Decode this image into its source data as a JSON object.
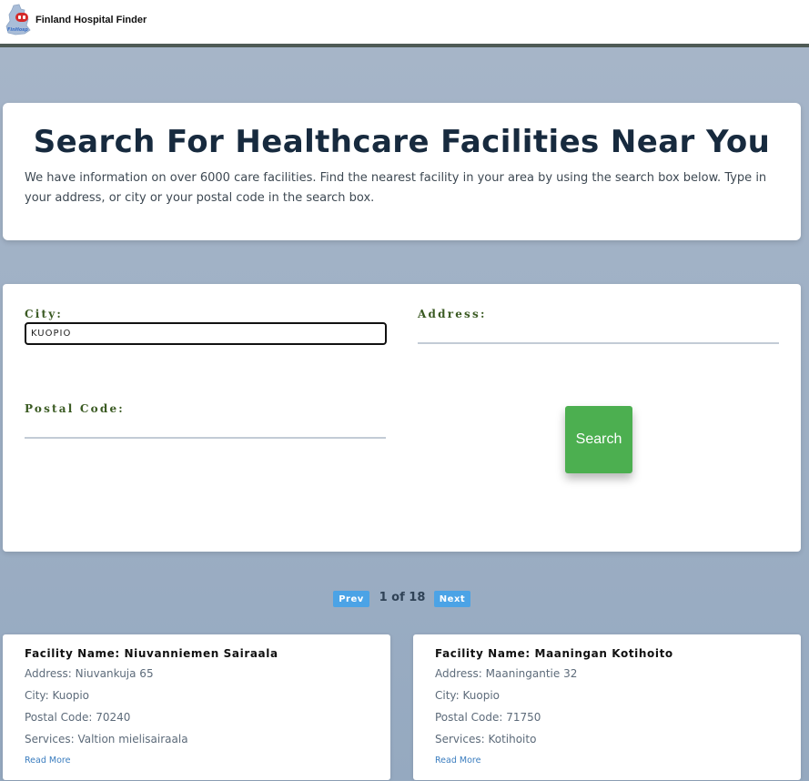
{
  "navbar": {
    "brand": "Finland Hospital Finder",
    "logo_icon": "finland-map-logo-icon",
    "logo_colors": {
      "map": "#a9bdd8",
      "badge": "#d42a2a"
    }
  },
  "hero": {
    "title": "Search For Healthcare Facilities Near You",
    "description": "We have information on over 6000 care facilities. Find the nearest facility in your area by using the search box below. Type in your address, or city or your postal code in the search box."
  },
  "form": {
    "city_label": "City:",
    "city_value": "KUOPIO",
    "address_label": "Address:",
    "address_value": "",
    "postal_label": "Postal Code:",
    "postal_value": "",
    "search_button": "Search"
  },
  "pagination": {
    "prev": "Prev",
    "next": "Next",
    "indicator": "1 of 18"
  },
  "results": [
    {
      "name": "Facility Name: Niuvanniemen Sairaala",
      "address": "Address: Niuvankuja 65",
      "city": "City: Kuopio",
      "postal": "Postal Code: 70240",
      "services": "Services: Valtion mielisairaala",
      "read_more": "Read More"
    },
    {
      "name": "Facility Name: Maaningan Kotihoito",
      "address": "Address: Maaningantie 32",
      "city": "City: Kuopio",
      "postal": "Postal Code: 71750",
      "services": "Services: Kotihoito",
      "read_more": "Read More"
    }
  ],
  "colors": {
    "accent_button": "#4caf50",
    "pager_button": "#4ba3e6",
    "label_text": "#3a5a22",
    "title_text": "#172a3e"
  }
}
